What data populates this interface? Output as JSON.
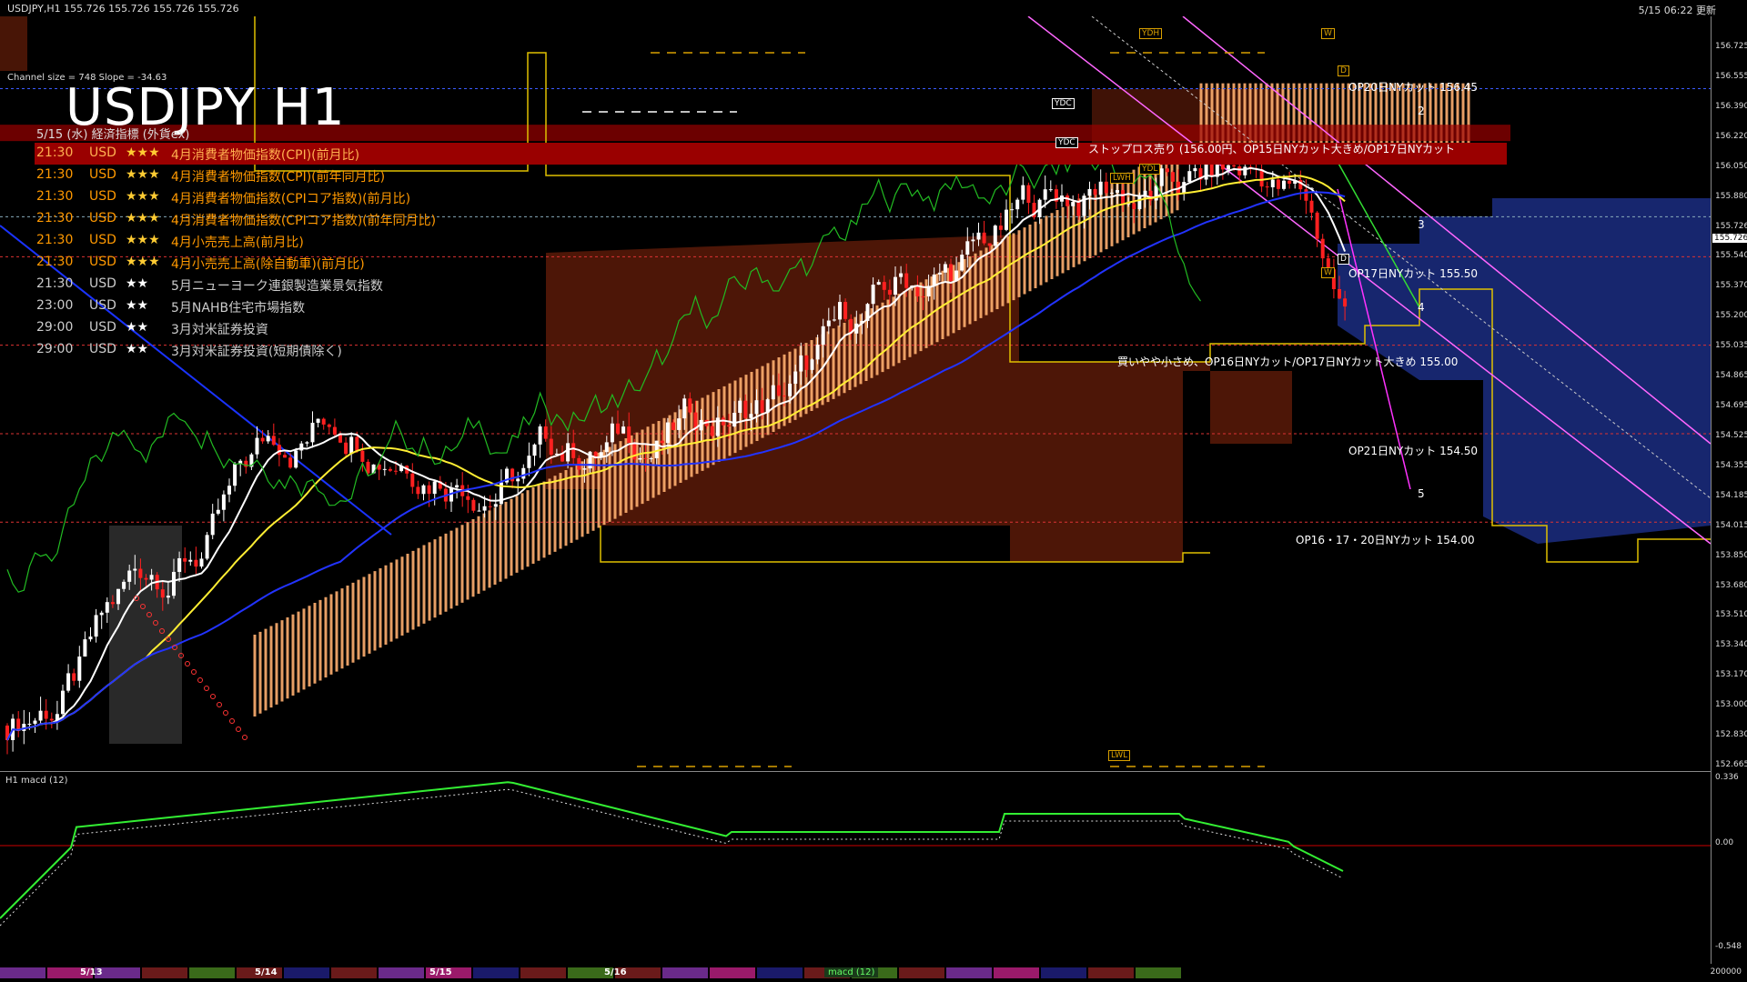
{
  "header": {
    "left": "USDJPY,H1  155.726 155.726 155.726 155.726",
    "right": "5/15 06:22 更新"
  },
  "chart_info": {
    "channel": "Channel size = 748 Slope = -34.63",
    "title": "USDJPY H1"
  },
  "econ": {
    "header": "5/15 (水) 経済指標 (外貨ex)",
    "rows": [
      {
        "time": "21:30",
        "cur": "USD",
        "stars": "★★★",
        "title": "4月消費者物価指数(CPI)(前月比)",
        "tone": "highlight"
      },
      {
        "time": "21:30",
        "cur": "USD",
        "stars": "★★★",
        "title": "4月消費者物価指数(CPI)(前年同月比)",
        "tone": "orange"
      },
      {
        "time": "21:30",
        "cur": "USD",
        "stars": "★★★",
        "title": "4月消費者物価指数(CPIコア指数)(前月比)",
        "tone": "orange"
      },
      {
        "time": "21:30",
        "cur": "USD",
        "stars": "★★★",
        "title": "4月消費者物価指数(CPIコア指数)(前年同月比)",
        "tone": "orange"
      },
      {
        "time": "21:30",
        "cur": "USD",
        "stars": "★★★",
        "title": "4月小売売上高(前月比)",
        "tone": "orange"
      },
      {
        "time": "21:30",
        "cur": "USD",
        "stars": "★★★",
        "title": "4月小売売上高(除自動車)(前月比)",
        "tone": "orange"
      },
      {
        "time": "21:30",
        "cur": "USD",
        "stars": "★★",
        "title": "5月ニューヨーク連銀製造業景気指数",
        "tone": "gray"
      },
      {
        "time": "23:00",
        "cur": "USD",
        "stars": "★★",
        "title": "5月NAHB住宅市場指数",
        "tone": "gray"
      },
      {
        "time": "29:00",
        "cur": "USD",
        "stars": "★★",
        "title": "3月対米証券投資",
        "tone": "gray"
      },
      {
        "time": "29:00",
        "cur": "USD",
        "stars": "★★",
        "title": "3月対米証券投資(短期債除く)",
        "tone": "gray"
      }
    ]
  },
  "annotations": {
    "op20": "OP20日NYカット 156.45",
    "stop": "ストップロス売り (156.00円、OP15日NYカット大きめ/OP17日NYカット",
    "op17": "OP17日NYカット 155.50",
    "buy": "買いやや小さめ、OP16日NYカット/OP17日NYカット大きめ 155.00",
    "op21": "OP21日NYカット 154.50",
    "op16": "OP16・17・20日NYカット 154.00"
  },
  "wave_labels": [
    "2",
    "3",
    "4",
    "5"
  ],
  "tags": {
    "ydh": "YDH",
    "w": "W",
    "d": "D",
    "ydc": "YDC",
    "ydc2": "YDC",
    "ydl": "YDL",
    "lwh": "LWH",
    "lwl": "LWL",
    "d2": "D",
    "w2": "W"
  },
  "price_axis": {
    "current": "155.726",
    "ticks": [
      "156.725",
      "156.555",
      "156.390",
      "156.220",
      "156.050",
      "155.880",
      "155.726",
      "155.540",
      "155.370",
      "155.200",
      "155.035",
      "154.865",
      "154.695",
      "154.525",
      "154.355",
      "154.185",
      "154.015",
      "153.850",
      "153.680",
      "153.510",
      "153.340",
      "153.170",
      "153.000",
      "152.830",
      "152.665"
    ]
  },
  "macd": {
    "label": "H1  macd (12)",
    "ticks": [
      "0.336",
      "0.00",
      "-0.548"
    ]
  },
  "date_bar": {
    "labels": [
      "5/13",
      "5/14",
      "5/15",
      "5/16"
    ],
    "macd_tab": "macd (12)",
    "zoom": "200000"
  },
  "colors": {
    "bull": "#ffffff",
    "bear": "#ff2020",
    "cloud_a": "#ffb070",
    "cloud_b": "#5a1a08",
    "kumo_blue": "#1a2a7a",
    "ma_white": "#ffffff",
    "ma_yellow": "#ffee33",
    "ma_blue": "#2233ff",
    "macd_green": "#33ee33",
    "highlight_red": "#9a0000"
  }
}
